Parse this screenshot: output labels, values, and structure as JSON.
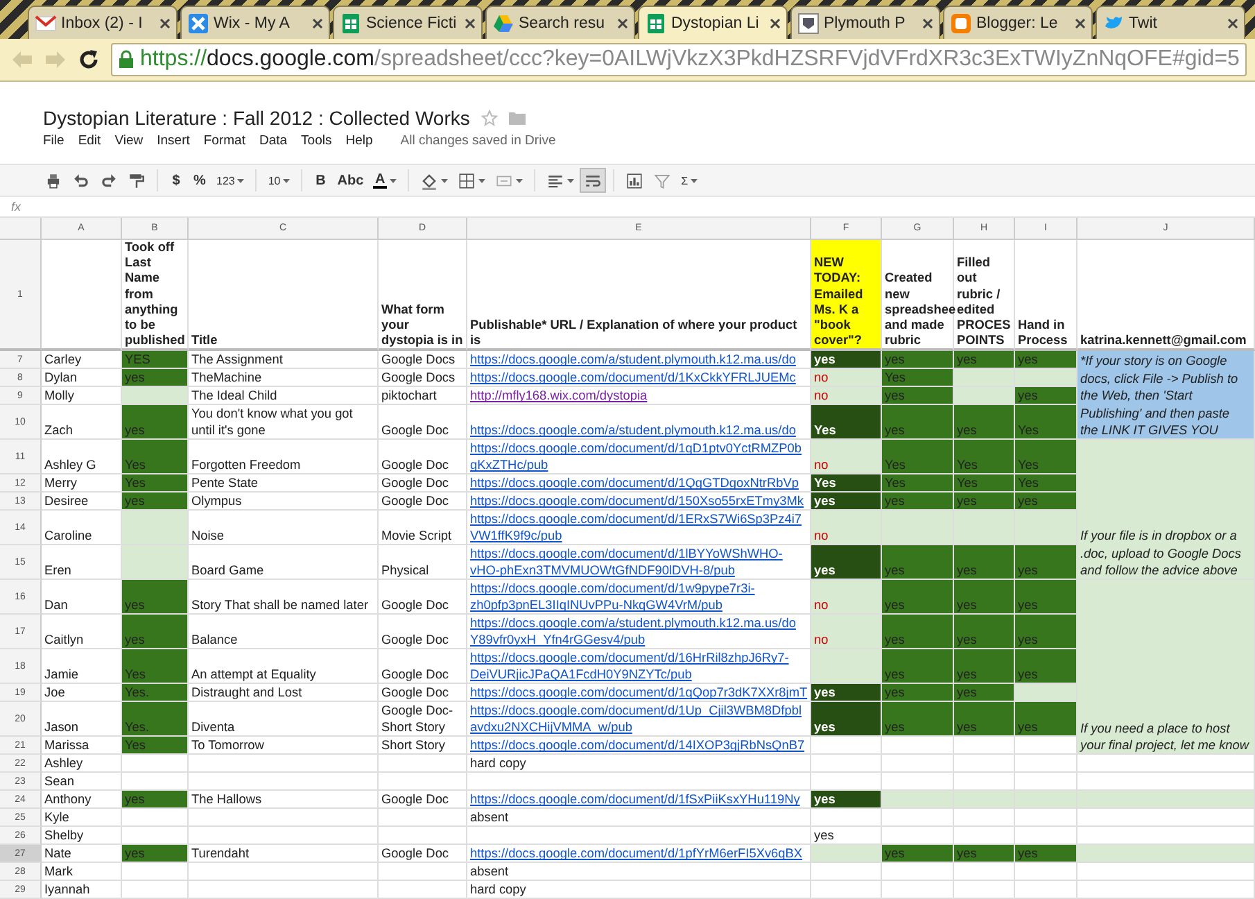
{
  "browser": {
    "tabs": [
      {
        "title": "Inbox (2) - I",
        "kind": "mail",
        "selected": false
      },
      {
        "title": "Wix - My A",
        "kind": "wix",
        "selected": false
      },
      {
        "title": "Science Ficti",
        "kind": "sheet",
        "selected": false
      },
      {
        "title": "Search resu",
        "kind": "drive",
        "selected": false
      },
      {
        "title": "Dystopian Li",
        "kind": "sheet",
        "selected": true
      },
      {
        "title": "Plymouth P",
        "kind": "crest",
        "selected": false
      },
      {
        "title": "Blogger: Le",
        "kind": "blogger",
        "selected": false
      },
      {
        "title": "Twit",
        "kind": "bird",
        "selected": false
      }
    ],
    "back_disabled": true,
    "forward_disabled": true,
    "url": {
      "scheme": "https://",
      "host": "docs.google.com",
      "path": "/spreadsheet/ccc?key=0AILWjVkzX3PkdHZSRFVjdVFrdXR3c3ExTWIyZnNqOFE#gid=5"
    }
  },
  "document": {
    "title": "Dystopian Literature : Fall 2012 : Collected Works",
    "starred": false,
    "menu": [
      "File",
      "Edit",
      "View",
      "Insert",
      "Format",
      "Data",
      "Tools",
      "Help"
    ],
    "save_status": "All changes saved in Drive"
  },
  "toolbar": [
    {
      "kind": "print",
      "on": false
    },
    {
      "kind": "undo",
      "on": false
    },
    {
      "kind": "redo",
      "on": false
    },
    {
      "kind": "paint",
      "on": false
    },
    {
      "kind": "separator"
    },
    {
      "kind": "currency",
      "label": "$",
      "on": false
    },
    {
      "kind": "percent",
      "label": "%",
      "on": false
    },
    {
      "kind": "number-format",
      "label": "123",
      "on": false
    },
    {
      "kind": "separator"
    },
    {
      "kind": "font-size",
      "label": "10",
      "on": false
    },
    {
      "kind": "separator"
    },
    {
      "kind": "bold",
      "label": "B",
      "on": false
    },
    {
      "kind": "strikethrough",
      "label": "Abc",
      "on": false
    },
    {
      "kind": "text-color",
      "label": "A",
      "on": false
    },
    {
      "kind": "separator"
    },
    {
      "kind": "fill",
      "on": false
    },
    {
      "kind": "borders",
      "on": false
    },
    {
      "kind": "merge",
      "on": false
    },
    {
      "kind": "separator"
    },
    {
      "kind": "align",
      "on": false
    },
    {
      "kind": "wrap",
      "on": true
    },
    {
      "kind": "separator"
    },
    {
      "kind": "chart",
      "on": false
    },
    {
      "kind": "filter",
      "on": false
    },
    {
      "kind": "functions",
      "label": "Σ",
      "on": false
    }
  ],
  "formula_bar": {
    "label": "fx"
  },
  "sheet": {
    "columns": [
      "A",
      "B",
      "C",
      "D",
      "E",
      "F",
      "G",
      "H",
      "I",
      "J"
    ],
    "header_row": {
      "number": "1",
      "cells": [
        {},
        {
          "text": "Took off Last Name from anything to be published"
        },
        {
          "text": "Title"
        },
        {
          "text": "What form your dystopia is in"
        },
        {
          "text": "Publishable* URL / Explanation of where your product is"
        },
        {
          "text": "NEW TODAY: Emailed Ms. K a \"book cover\"?",
          "color": "#ffff00"
        },
        {
          "text": "Created new spreadshee and made rubric"
        },
        {
          "text": "Filled out rubric / edited PROCES POINTS"
        },
        {
          "text": "Hand in Process"
        },
        {
          "text": "katrina.kennett@gmail.com"
        }
      ]
    },
    "rows": [
      {
        "number": "7",
        "selected": false,
        "cells": [
          {
            "text": "Carley",
            "kind": "text"
          },
          {
            "text": "YES",
            "kind": "text",
            "color": "#38761d"
          },
          {
            "text": "The Assignment",
            "kind": "text"
          },
          {
            "text": "Google Docs",
            "kind": "text"
          },
          {
            "text": "https://docs.google.com/a/student.plymouth.k12.ma.us/do",
            "kind": "link"
          },
          {
            "text": "yes",
            "kind": "inverse",
            "color": "#274e13"
          },
          {
            "text": "yes",
            "kind": "text",
            "color": "#38761d"
          },
          {
            "text": "yes",
            "kind": "text",
            "color": "#38761d"
          },
          {
            "text": "yes",
            "kind": "text",
            "color": "#38761d"
          },
          {
            "text": "*If your story is on Google docs, click File -> Publish to the Web, then 'Start Publishing' and then paste the LINK IT GIVES YOU",
            "kind": "note",
            "color": "#9fc5e8",
            "rowspan": 4
          }
        ]
      },
      {
        "number": "8",
        "selected": false,
        "cells": [
          {
            "text": "Dylan",
            "kind": "text"
          },
          {
            "text": "yes",
            "kind": "text",
            "color": "#38761d"
          },
          {
            "text": "TheMachine",
            "kind": "text"
          },
          {
            "text": "Google Docs",
            "kind": "text"
          },
          {
            "text": "https://docs.google.com/document/d/1KxCkkYFRLJUEMc",
            "kind": "link"
          },
          {
            "text": "no",
            "kind": "alert",
            "color": "#d9ead3"
          },
          {
            "text": "Yes",
            "kind": "text",
            "color": "#38761d"
          },
          {
            "color": "#d9ead3"
          },
          {
            "color": "#d9ead3"
          }
        ]
      },
      {
        "number": "9",
        "selected": false,
        "cells": [
          {
            "text": "Molly",
            "kind": "text"
          },
          {
            "color": "#d9ead3"
          },
          {
            "text": "The Ideal Child",
            "kind": "text"
          },
          {
            "text": "piktochart",
            "kind": "text"
          },
          {
            "text": "http://mfly168.wix.com/dystopia",
            "kind": "visited-link"
          },
          {
            "text": "no",
            "kind": "alert",
            "color": "#d9ead3"
          },
          {
            "text": "yes",
            "kind": "text",
            "color": "#38761d"
          },
          {
            "color": "#d9ead3"
          },
          {
            "text": "yes",
            "kind": "text",
            "color": "#38761d"
          }
        ]
      },
      {
        "number": "10",
        "selected": false,
        "cells": [
          {
            "text": "Zach",
            "kind": "text"
          },
          {
            "text": "yes",
            "kind": "text",
            "color": "#38761d"
          },
          {
            "text": "You don't know what you got until it's gone",
            "kind": "text"
          },
          {
            "text": "Google Doc",
            "kind": "text"
          },
          {
            "text": "https://docs.google.com/a/student.plymouth.k12.ma.us/do",
            "kind": "link"
          },
          {
            "text": "Yes",
            "kind": "inverse",
            "color": "#274e13"
          },
          {
            "text": "yes",
            "kind": "text",
            "color": "#38761d"
          },
          {
            "text": "yes",
            "kind": "text",
            "color": "#38761d"
          },
          {
            "text": "Yes",
            "kind": "text",
            "color": "#38761d"
          }
        ]
      },
      {
        "number": "11",
        "selected": false,
        "cells": [
          {
            "text": "Ashley G",
            "kind": "text"
          },
          {
            "text": "Yes",
            "kind": "text",
            "color": "#38761d"
          },
          {
            "text": "Forgotten Freedom",
            "kind": "text"
          },
          {
            "text": "Google Doc",
            "kind": "text"
          },
          {
            "text": "https://docs.google.com/document/d/1qD1ptv0YctRMZP0b\ngKxZTHc/pub",
            "kind": "link"
          },
          {
            "text": "no",
            "kind": "alert",
            "color": "#d9ead3"
          },
          {
            "text": "Yes",
            "kind": "text",
            "color": "#38761d"
          },
          {
            "text": "Yes",
            "kind": "text",
            "color": "#38761d"
          },
          {
            "text": "Yes",
            "kind": "text",
            "color": "#38761d"
          },
          {
            "text": "If your file is in dropbox or a .doc, upload to Google Docs and follow the advice above",
            "kind": "note",
            "color": "#d9ead3",
            "rowspan": 5
          }
        ]
      },
      {
        "number": "12",
        "selected": false,
        "cells": [
          {
            "text": "Merry",
            "kind": "text"
          },
          {
            "text": "Yes",
            "kind": "text",
            "color": "#38761d"
          },
          {
            "text": "Pente State",
            "kind": "text"
          },
          {
            "text": "Google Doc",
            "kind": "text"
          },
          {
            "text": "https://docs.google.com/document/d/1QgGTDgoxNtrRbVp",
            "kind": "link"
          },
          {
            "text": "Yes",
            "kind": "inverse",
            "color": "#274e13"
          },
          {
            "text": "Yes",
            "kind": "text",
            "color": "#38761d"
          },
          {
            "text": "Yes",
            "kind": "text",
            "color": "#38761d"
          },
          {
            "text": "Yes",
            "kind": "text",
            "color": "#38761d"
          }
        ]
      },
      {
        "number": "13",
        "selected": false,
        "cells": [
          {
            "text": "Desiree",
            "kind": "text"
          },
          {
            "text": "yes",
            "kind": "text",
            "color": "#38761d"
          },
          {
            "text": "Olympus",
            "kind": "text"
          },
          {
            "text": "Google Doc",
            "kind": "text"
          },
          {
            "text": "https://docs.google.com/document/d/150Xso55rxETmy3Mk",
            "kind": "link"
          },
          {
            "text": "yes",
            "kind": "inverse",
            "color": "#274e13"
          },
          {
            "text": "yes",
            "kind": "text",
            "color": "#38761d"
          },
          {
            "text": "yes",
            "kind": "text",
            "color": "#38761d"
          },
          {
            "text": "yes",
            "kind": "text",
            "color": "#38761d"
          }
        ]
      },
      {
        "number": "14",
        "selected": false,
        "cells": [
          {
            "text": "Caroline",
            "kind": "text"
          },
          {
            "color": "#d9ead3"
          },
          {
            "text": "Noise",
            "kind": "text"
          },
          {
            "text": "Movie Script",
            "kind": "text"
          },
          {
            "text": "https://docs.google.com/document/d/1ERxS7Wi6Sp3Pz4i7\nVW1ffK9f9c/pub",
            "kind": "link"
          },
          {
            "text": "no",
            "kind": "alert",
            "color": "#d9ead3"
          },
          {
            "color": "#d9ead3"
          },
          {
            "color": "#d9ead3"
          },
          {
            "color": "#d9ead3"
          }
        ]
      },
      {
        "number": "15",
        "selected": false,
        "cells": [
          {
            "text": "Eren",
            "kind": "text"
          },
          {
            "color": "#d9ead3"
          },
          {
            "text": "Board Game",
            "kind": "text"
          },
          {
            "text": "Physical",
            "kind": "text"
          },
          {
            "text": "https://docs.google.com/document/d/1lBYYoWShWHO-\nvHO-phExn3TMVMUOWtGfNDF90lDVH-8/pub",
            "kind": "link"
          },
          {
            "text": "yes",
            "kind": "inverse",
            "color": "#274e13"
          },
          {
            "text": "yes",
            "kind": "text",
            "color": "#38761d"
          },
          {
            "text": "yes",
            "kind": "text",
            "color": "#38761d"
          },
          {
            "text": "yes",
            "kind": "text",
            "color": "#38761d"
          }
        ]
      },
      {
        "number": "16",
        "selected": false,
        "cells": [
          {
            "text": "Dan",
            "kind": "text"
          },
          {
            "text": "yes",
            "kind": "text",
            "color": "#38761d"
          },
          {
            "text": "Story That shall be named later",
            "kind": "text"
          },
          {
            "text": "Google Doc",
            "kind": "text"
          },
          {
            "text": "https://docs.google.com/document/d/1w9pype7r3i-\nzh0pfp3pnEL3IIqINUvPPu-NkqGW4VrM/pub",
            "kind": "link"
          },
          {
            "text": "no",
            "kind": "alert",
            "color": "#d9ead3"
          },
          {
            "text": "yes",
            "kind": "text",
            "color": "#38761d"
          },
          {
            "text": "yes",
            "kind": "text",
            "color": "#38761d"
          },
          {
            "text": "yes",
            "kind": "text",
            "color": "#38761d"
          },
          {
            "text": "If you need a place to host your final project, let me know",
            "kind": "note",
            "color": "#d9ead3",
            "rowspan": 6
          }
        ]
      },
      {
        "number": "17",
        "selected": false,
        "cells": [
          {
            "text": "Caitlyn",
            "kind": "text"
          },
          {
            "text": "yes",
            "kind": "text",
            "color": "#38761d"
          },
          {
            "text": "Balance",
            "kind": "text"
          },
          {
            "text": "Google Doc",
            "kind": "text"
          },
          {
            "text": "https://docs.google.com/a/student.plymouth.k12.ma.us/do\nY89vfr0yxH_Yfn4rGGesv4/pub",
            "kind": "link"
          },
          {
            "text": "no",
            "kind": "alert",
            "color": "#d9ead3"
          },
          {
            "text": "yes",
            "kind": "text",
            "color": "#38761d"
          },
          {
            "text": "yes",
            "kind": "text",
            "color": "#38761d"
          },
          {
            "text": "yes",
            "kind": "text",
            "color": "#38761d"
          }
        ]
      },
      {
        "number": "18",
        "selected": false,
        "cells": [
          {
            "text": "Jamie",
            "kind": "text"
          },
          {
            "text": "Yes",
            "kind": "text",
            "color": "#38761d"
          },
          {
            "text": "An attempt at Equality",
            "kind": "text"
          },
          {
            "text": "Google Doc",
            "kind": "text"
          },
          {
            "text": "https://docs.google.com/document/d/16HrRil8zhpJ6Ry7-\nDeiVURjicJPaQA1FcdH0Y9NZYTc/pub",
            "kind": "link"
          },
          {
            "color": "#d9ead3"
          },
          {
            "text": "yes",
            "kind": "text",
            "color": "#38761d"
          },
          {
            "text": "yes",
            "kind": "text",
            "color": "#38761d"
          },
          {
            "text": "yes",
            "kind": "text",
            "color": "#38761d"
          }
        ]
      },
      {
        "number": "19",
        "selected": false,
        "cells": [
          {
            "text": "Joe",
            "kind": "text"
          },
          {
            "text": "Yes.",
            "kind": "text",
            "color": "#38761d"
          },
          {
            "text": "Distraught and Lost",
            "kind": "text"
          },
          {
            "text": "Google Doc",
            "kind": "text"
          },
          {
            "text": "https://docs.google.com/document/d/1qQop7r3dK7XXr8jmT",
            "kind": "link"
          },
          {
            "text": "yes",
            "kind": "inverse",
            "color": "#274e13"
          },
          {
            "text": "yes",
            "kind": "text",
            "color": "#38761d"
          },
          {
            "text": "yes",
            "kind": "text",
            "color": "#38761d"
          },
          {
            "color": "#d9ead3"
          }
        ]
      },
      {
        "number": "20",
        "selected": false,
        "cells": [
          {
            "text": "Jason",
            "kind": "text"
          },
          {
            "text": "Yes.",
            "kind": "text",
            "color": "#38761d"
          },
          {
            "text": "Diventa",
            "kind": "text"
          },
          {
            "text": "Google Doc- Short Story",
            "kind": "text"
          },
          {
            "text": "https://docs.google.com/document/d/1Up_Cjil3WBM8Dfpbl\navdxu2NXCHijVMMA_w/pub",
            "kind": "link"
          },
          {
            "text": "yes",
            "kind": "inverse",
            "color": "#274e13"
          },
          {
            "text": "yes",
            "kind": "text",
            "color": "#38761d"
          },
          {
            "text": "yes",
            "kind": "text",
            "color": "#38761d"
          },
          {
            "text": "yes",
            "kind": "text",
            "color": "#38761d"
          }
        ]
      },
      {
        "number": "21",
        "selected": false,
        "cells": [
          {
            "text": "Marissa",
            "kind": "text"
          },
          {
            "text": "Yes",
            "kind": "text",
            "color": "#38761d"
          },
          {
            "text": "To Tomorrow",
            "kind": "text"
          },
          {
            "text": "Short Story",
            "kind": "text"
          },
          {
            "text": "https://docs.google.com/document/d/14IXOP3gjRbNsQnB7",
            "kind": "link"
          },
          {},
          {},
          {},
          {}
        ]
      },
      {
        "number": "22",
        "selected": false,
        "cells": [
          {
            "text": "Ashley",
            "kind": "text"
          },
          {},
          {},
          {},
          {
            "text": "hard copy",
            "kind": "text"
          },
          {},
          {},
          {},
          {},
          {}
        ]
      },
      {
        "number": "23",
        "selected": false,
        "cells": [
          {
            "text": "Sean",
            "kind": "text"
          },
          {},
          {},
          {},
          {},
          {},
          {},
          {},
          {},
          {}
        ]
      },
      {
        "number": "24",
        "selected": false,
        "cells": [
          {
            "text": "Anthony",
            "kind": "text"
          },
          {
            "text": "yes",
            "kind": "text",
            "color": "#38761d"
          },
          {
            "text": "The Hallows",
            "kind": "text"
          },
          {
            "text": "Google Doc",
            "kind": "text"
          },
          {
            "text": "https://docs.google.com/document/d/1fSxPiiKsxYHu119Ny",
            "kind": "link"
          },
          {
            "text": "yes",
            "kind": "inverse",
            "color": "#274e13"
          },
          {
            "color": "#d9ead3"
          },
          {
            "color": "#d9ead3"
          },
          {
            "color": "#d9ead3"
          },
          {
            "color": "#d9ead3"
          }
        ]
      },
      {
        "number": "25",
        "selected": false,
        "cells": [
          {
            "text": "Kyle",
            "kind": "text"
          },
          {},
          {},
          {},
          {
            "text": "absent",
            "kind": "text"
          },
          {},
          {},
          {},
          {},
          {}
        ]
      },
      {
        "number": "26",
        "selected": false,
        "cells": [
          {
            "text": "Shelby",
            "kind": "text"
          },
          {},
          {},
          {},
          {},
          {
            "text": "yes",
            "kind": "text"
          },
          {},
          {},
          {},
          {}
        ]
      },
      {
        "number": "27",
        "selected": true,
        "cells": [
          {
            "text": "Nate",
            "kind": "text"
          },
          {
            "text": "yes",
            "kind": "text",
            "color": "#38761d"
          },
          {
            "text": "Turendaht",
            "kind": "text"
          },
          {
            "text": "Google Doc",
            "kind": "text"
          },
          {
            "text": "https://docs.google.com/document/d/1pfYrM6erFI5Xv6qBX",
            "kind": "link"
          },
          {
            "color": "#d9ead3"
          },
          {
            "text": "yes",
            "kind": "text",
            "color": "#38761d"
          },
          {
            "text": "yes",
            "kind": "text",
            "color": "#38761d"
          },
          {
            "text": "yes",
            "kind": "text",
            "color": "#38761d"
          },
          {
            "color": "#d9ead3"
          }
        ]
      },
      {
        "number": "28",
        "selected": false,
        "cells": [
          {
            "text": "Mark",
            "kind": "text"
          },
          {},
          {},
          {},
          {
            "text": "absent",
            "kind": "text"
          },
          {},
          {},
          {},
          {},
          {}
        ]
      },
      {
        "number": "29",
        "selected": false,
        "cells": [
          {
            "text": "Iyannah",
            "kind": "text"
          },
          {},
          {},
          {},
          {
            "text": "hard copy",
            "kind": "text"
          },
          {},
          {},
          {},
          {},
          {}
        ]
      }
    ]
  }
}
